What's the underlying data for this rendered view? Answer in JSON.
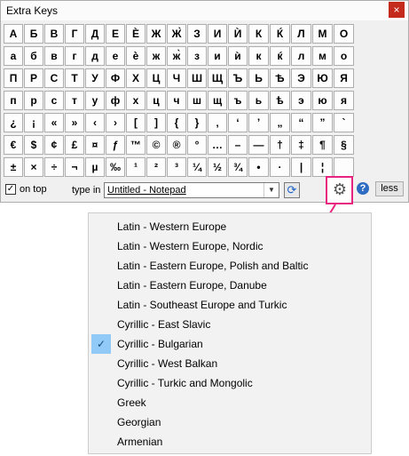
{
  "window": {
    "title": "Extra Keys",
    "close": "×"
  },
  "keys": [
    [
      "А",
      "Б",
      "В",
      "Г",
      "Д",
      "Е",
      "Ѐ",
      "Ж",
      "Ж̀",
      "З",
      "И",
      "Ѝ",
      "К",
      "Ќ",
      "Л",
      "М",
      "О"
    ],
    [
      "а",
      "б",
      "в",
      "г",
      "д",
      "е",
      "ѐ",
      "ж",
      "ж̀",
      "з",
      "и",
      "ѝ",
      "к",
      "ќ",
      "л",
      "м",
      "о"
    ],
    [
      "П",
      "Р",
      "С",
      "Т",
      "У",
      "Ф",
      "Х",
      "Ц",
      "Ч",
      "Ш",
      "Щ",
      "Ъ",
      "Ь",
      "Ѣ",
      "Э",
      "Ю",
      "Я"
    ],
    [
      "п",
      "р",
      "с",
      "т",
      "у",
      "ф",
      "х",
      "ц",
      "ч",
      "ш",
      "щ",
      "ъ",
      "ь",
      "ѣ",
      "э",
      "ю",
      "я"
    ],
    [
      "¿",
      "¡",
      "«",
      "»",
      "‹",
      "›",
      "[",
      "]",
      "{",
      "}",
      "‚",
      "‘",
      "’",
      "„",
      "“",
      "”",
      "`"
    ],
    [
      "€",
      "$",
      "¢",
      "£",
      "¤",
      "ƒ",
      "™",
      "©",
      "®",
      "°",
      "…",
      "–",
      "—",
      "†",
      "‡",
      "¶",
      "§"
    ],
    [
      "±",
      "×",
      "÷",
      "¬",
      "µ",
      "‰",
      "¹",
      "²",
      "³",
      "¼",
      "½",
      "¾",
      "•",
      "·",
      "|",
      "¦",
      ""
    ]
  ],
  "bottom": {
    "ontop_label": "on top",
    "ontop_checked": "✓",
    "typein_label": "type in",
    "target_value": "Untitled - Notepad",
    "dropdown_arrow": "▼",
    "refresh_glyph": "⟳",
    "gear_glyph": "⚙",
    "help_glyph": "?",
    "less_label": "less"
  },
  "menu": {
    "items": [
      "Latin - Western Europe",
      "Latin - Western Europe, Nordic",
      "Latin - Eastern Europe, Polish and Baltic",
      "Latin - Eastern Europe, Danube",
      "Latin - Southeast Europe and Turkic",
      "Cyrillic - East Slavic",
      "Cyrillic - Bulgarian",
      "Cyrillic - West Balkan",
      "Cyrillic - Turkic and Mongolic",
      "Greek",
      "Georgian",
      "Armenian"
    ],
    "selected_index": 6,
    "check_glyph": "✓"
  },
  "colors": {
    "highlight": "#e8237f",
    "selection": "#91c9f7"
  }
}
